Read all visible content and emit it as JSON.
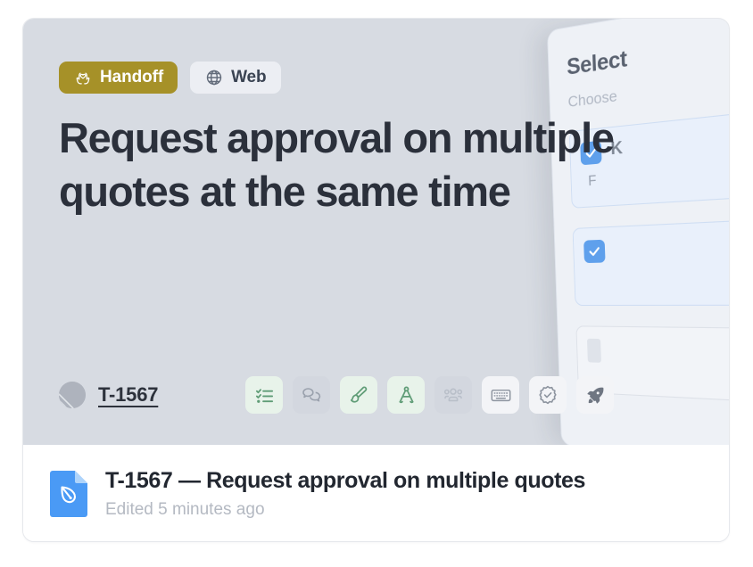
{
  "card": {
    "preview": {
      "background_color": "#d7dbe2",
      "badges": [
        {
          "label": "Handoff",
          "icon": "hands-heart-icon",
          "style": "accent",
          "color": "#a69128"
        },
        {
          "label": "Web",
          "icon": "globe-icon",
          "style": "neutral",
          "color": "#eceef3"
        }
      ],
      "title": "Request approval on multiple quotes at the same time",
      "ticket": {
        "avatar_icon": "hatched-circle-avatar",
        "id": "T-1567"
      },
      "tools": [
        {
          "name": "checklist-icon",
          "state": "active",
          "color": "#5f9c76"
        },
        {
          "name": "comments-icon",
          "state": "muted",
          "color": "#9aa1ad"
        },
        {
          "name": "paintbrush-icon",
          "state": "active",
          "color": "#5f9c76"
        },
        {
          "name": "compass-icon",
          "state": "active",
          "color": "#5f9c76"
        },
        {
          "name": "users-icon",
          "state": "muted",
          "color": "#b9bfc9"
        },
        {
          "name": "keyboard-icon",
          "state": "default",
          "color": "#8d949f"
        },
        {
          "name": "verified-badge-icon",
          "state": "default",
          "color": "#8d949f"
        },
        {
          "name": "rocket-icon",
          "state": "default",
          "color": "#6f7682"
        }
      ],
      "side_panel": {
        "title": "Select",
        "subtitle": "Choose",
        "options": [
          {
            "checked": true,
            "label": "K",
            "detail": "F"
          },
          {
            "checked": true,
            "label": "",
            "detail": ""
          }
        ]
      }
    },
    "footer": {
      "file_icon": "blue-document-pen-icon",
      "title": "T-1567 — Request approval on multiple quotes",
      "subtitle": "Edited 5 minutes ago"
    }
  }
}
